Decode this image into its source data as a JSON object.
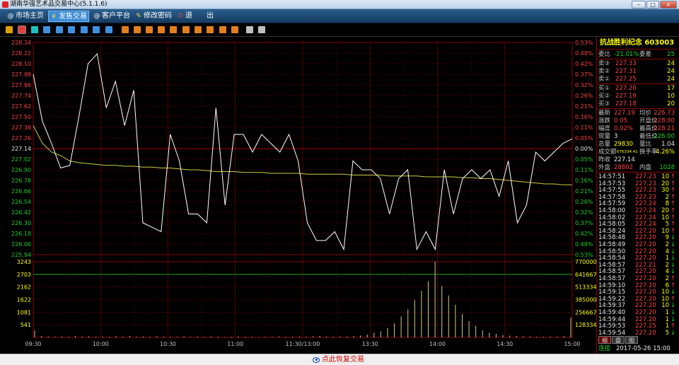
{
  "window": {
    "title": "湖南华强艺术品交易中心(5.1.1.6)",
    "min": "–",
    "max": "□",
    "close": "×"
  },
  "menu": [
    {
      "label": "市场主页",
      "icon": "@"
    },
    {
      "label": "发售交易",
      "icon": "¥"
    },
    {
      "label": "客户平台",
      "icon": "@"
    },
    {
      "label": "修改密码",
      "icon": "✎"
    },
    {
      "label": "退",
      "icon": "⏻"
    },
    {
      "label": "出",
      "icon": ""
    }
  ],
  "toolbar_icons": [
    "bar-chart-icon",
    "line-chart-icon",
    "volume-icon",
    "calendar-icon",
    "grid-icon",
    "list-icon",
    "index-icon",
    "window-icon",
    "export-icon",
    "f1-icon",
    "f2-icon",
    "f3-icon",
    "f4-icon",
    "f5-icon",
    "f6-icon",
    "f7-icon",
    "f8-icon",
    "f9-icon",
    "f10-icon",
    "draw-icon",
    "settings-icon"
  ],
  "colors": {
    "up": "#ff4040",
    "down": "#20d020",
    "grid": "#8b0000",
    "price_line": "#ffffff",
    "avg_line": "#cccc44",
    "volume": "#cccc88",
    "accent": "#ffff00"
  },
  "quote": {
    "name": "抗战胜利纪念",
    "code": "603003",
    "weibi": {
      "label": "委比",
      "value": "-21.01%"
    },
    "weicha": {
      "label": "委差",
      "value": "25"
    },
    "asks": [
      {
        "label": "卖③",
        "price": "227.33",
        "vol": "24"
      },
      {
        "label": "卖②",
        "price": "227.31",
        "vol": "24"
      },
      {
        "label": "卖①",
        "price": "227.25",
        "vol": "24"
      }
    ],
    "bids": [
      {
        "label": "买①",
        "price": "227.20",
        "vol": "17"
      },
      {
        "label": "买②",
        "price": "227.19",
        "vol": "10"
      },
      {
        "label": "买③",
        "price": "227.18",
        "vol": "20"
      }
    ],
    "stats": [
      {
        "l1": "最新",
        "v1": "227.19",
        "l2": "均价",
        "v2": "226.73",
        "c1": "up",
        "c2": "up"
      },
      {
        "l1": "涨跌",
        "v1": "0.05",
        "l2": "开盘价",
        "v2": "228.00",
        "c1": "up",
        "c2": "up"
      },
      {
        "l1": "幅度",
        "v1": "0.02%",
        "l2": "最高价",
        "v2": "228.21",
        "c1": "up",
        "c2": "up"
      },
      {
        "l1": "现量",
        "v1": "3",
        "l2": "最低价",
        "v2": "226.00",
        "c1": "wht",
        "c2": "dn"
      },
      {
        "l1": "总量",
        "v1": "29830",
        "l2": "量比",
        "v2": "1.04",
        "c1": "yel",
        "c2": "wht"
      },
      {
        "l1": "成交额",
        "v1": "676334.41",
        "l2": "换手率",
        "v2": "4.26%",
        "c1": "yel",
        "c2": "yel"
      },
      {
        "l1": "昨收",
        "v1": "227.14",
        "l2": "",
        "v2": "",
        "c1": "wht",
        "c2": "wht"
      },
      {
        "l1": "外盘",
        "v1": "28802",
        "l2": "内盘",
        "v2": "1028",
        "c1": "up",
        "c2": "dn"
      }
    ],
    "ticks": [
      [
        "14:57:51",
        "227.23",
        "10",
        "up"
      ],
      [
        "14:57:53",
        "227.23",
        "20",
        "up"
      ],
      [
        "14:57:55",
        "227.23",
        "30",
        "up"
      ],
      [
        "14:57:58",
        "227.23",
        "2",
        "up"
      ],
      [
        "14:57:59",
        "227.24",
        "8",
        "up"
      ],
      [
        "14:58:00",
        "227.24",
        "20",
        "up"
      ],
      [
        "14:58:02",
        "227.24",
        "10",
        "up"
      ],
      [
        "14:58:05",
        "227.24",
        "5",
        "up"
      ],
      [
        "14:58:24",
        "227.20",
        "10",
        "up"
      ],
      [
        "14:58:48",
        "227.20",
        "9",
        "dn"
      ],
      [
        "14:58:49",
        "227.20",
        "2",
        "dn"
      ],
      [
        "14:58:50",
        "227.20",
        "4",
        "dn"
      ],
      [
        "14:58:54",
        "227.20",
        "1",
        "dn"
      ],
      [
        "14:58:57",
        "227.21",
        "2",
        "dn"
      ],
      [
        "14:58:57",
        "227.20",
        "4",
        "dn"
      ],
      [
        "14:58:57",
        "227.20",
        "2",
        "up"
      ],
      [
        "14:59:10",
        "227.20",
        "6",
        "up"
      ],
      [
        "14:59:15",
        "227.20",
        "10",
        "dn"
      ],
      [
        "14:59:22",
        "227.20",
        "10",
        "up"
      ],
      [
        "14:59:37",
        "227.20",
        "10",
        "dn"
      ],
      [
        "14:59:40",
        "227.20",
        "1",
        "dn"
      ],
      [
        "14:59:44",
        "227.20",
        "1",
        "dn"
      ],
      [
        "14:59:53",
        "227.25",
        "1",
        "up"
      ],
      [
        "14:59:54",
        "227.20",
        "5",
        "dn"
      ]
    ],
    "tabs": [
      "细",
      "盘",
      "图"
    ],
    "status_label": "连接",
    "status_time": "2017-05-26 15:00"
  },
  "footer": {
    "restore": "点此恢复交易"
  },
  "chart_data": {
    "type": "line",
    "price_axis": [
      "228.34",
      "228.22",
      "228.10",
      "227.98",
      "227.86",
      "227.74",
      "227.62",
      "227.50",
      "227.38",
      "227.26",
      "227.14",
      "227.02",
      "226.90",
      "226.78",
      "226.66",
      "226.54",
      "226.42",
      "226.30",
      "226.18",
      "226.06",
      "225.94"
    ],
    "pct_axis": [
      "0.53%",
      "0.48%",
      "0.42%",
      "0.37%",
      "0.32%",
      "0.26%",
      "0.21%",
      "0.16%",
      "0.11%",
      "0.05%",
      "0.00%",
      "0.05%",
      "0.11%",
      "0.16%",
      "0.21%",
      "0.26%",
      "0.32%",
      "0.37%",
      "0.42%",
      "0.48%",
      "0.53%"
    ],
    "vol_axis_left": [
      "3243",
      "2703",
      "2162",
      "1622",
      "1081",
      "541"
    ],
    "vol_axis_right": [
      "770000",
      "641667",
      "513334",
      "385000",
      "256667",
      "128334"
    ],
    "x_labels": [
      "09:30",
      "10:00",
      "10:30",
      "11:00",
      "11:30/13:00",
      "13:30",
      "14:00",
      "14:30",
      "15:00"
    ],
    "prev_close": 227.14,
    "ylim": [
      225.94,
      228.34
    ],
    "price": [
      227.98,
      227.45,
      227.2,
      226.92,
      226.95,
      227.5,
      228.1,
      228.21,
      227.6,
      227.9,
      227.4,
      227.8,
      226.3,
      226.25,
      226.2,
      227.3,
      227.0,
      226.4,
      226.4,
      226.3,
      227.6,
      226.5,
      227.3,
      227.3,
      227.1,
      227.3,
      227.2,
      227.1,
      227.3,
      227.0,
      226.3,
      226.1,
      226.1,
      226.2,
      226.0,
      227.0,
      226.9,
      226.9,
      226.8,
      226.4,
      226.8,
      226.9,
      226.0,
      226.2,
      226.0,
      226.9,
      226.4,
      226.8,
      226.9,
      226.8,
      226.9,
      226.6,
      227.0,
      226.3,
      226.5,
      227.1,
      227.0,
      227.1,
      227.2,
      227.25
    ],
    "avg": [
      227.4,
      227.2,
      227.1,
      227.06,
      227.0,
      226.98,
      226.97,
      226.96,
      226.95,
      226.95,
      226.94,
      226.94,
      226.93,
      226.93,
      226.92,
      226.92,
      226.91,
      226.9,
      226.9,
      226.89,
      226.88,
      226.88,
      226.88,
      226.87,
      226.87,
      226.87,
      226.86,
      226.86,
      226.86,
      226.86,
      226.85,
      226.85,
      226.85,
      226.85,
      226.85,
      226.84,
      226.84,
      226.84,
      226.84,
      226.83,
      226.83,
      226.83,
      226.83,
      226.82,
      226.82,
      226.82,
      226.82,
      226.81,
      226.81,
      226.8,
      226.8,
      226.79,
      226.78,
      226.77,
      226.76,
      226.75,
      226.74,
      226.74,
      226.73,
      226.73
    ],
    "volume_ylim": [
      0,
      3243
    ],
    "volume": [
      300,
      60,
      40,
      30,
      40,
      30,
      60,
      40,
      50,
      30,
      40,
      30,
      50,
      30,
      60,
      30,
      40,
      30,
      50,
      40,
      30,
      30,
      50,
      30,
      40,
      30,
      40,
      30,
      20,
      30,
      40,
      30,
      30,
      20,
      30,
      30,
      40,
      30,
      30,
      40,
      30,
      50,
      60,
      40,
      30,
      40,
      40,
      60,
      80,
      120,
      200,
      260,
      400,
      600,
      900,
      1200,
      1600,
      2000,
      2400,
      3243,
      2200,
      1800,
      1400,
      1000,
      700,
      500,
      300,
      200,
      150,
      100,
      80,
      60,
      50,
      40,
      30,
      30,
      40,
      30,
      60,
      850
    ]
  }
}
